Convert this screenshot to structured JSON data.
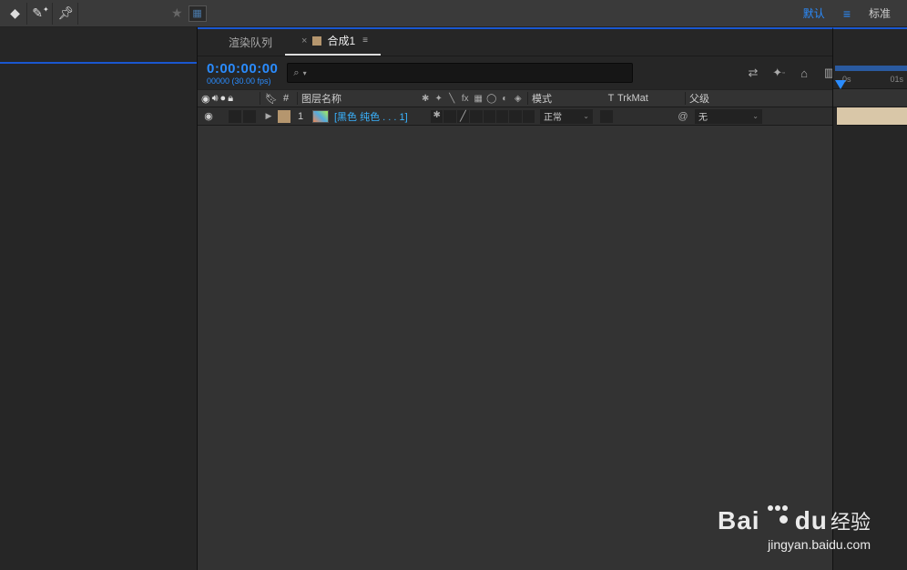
{
  "workspace": {
    "default": "默认",
    "standard": "标准"
  },
  "tabs": {
    "render_queue": "渲染队列",
    "comp": "合成1"
  },
  "timecode": {
    "main": "0:00:00:00",
    "sub": "00000 (30.00 fps)"
  },
  "columns": {
    "layer_name": "图层名称",
    "mode": "模式",
    "trkmat_t": "T",
    "trkmat": "TrkMat",
    "parent": "父级"
  },
  "layer": {
    "num": "1",
    "name": "[黑色 纯色 . . . 1]",
    "mode": "正常",
    "parent": "无"
  },
  "ruler": {
    "t0": "0s",
    "t1": "01s"
  },
  "watermark": {
    "brand_a": "Bai",
    "brand_b": "du",
    "brand_c": "经验",
    "url": "jingyan.baidu.com"
  }
}
